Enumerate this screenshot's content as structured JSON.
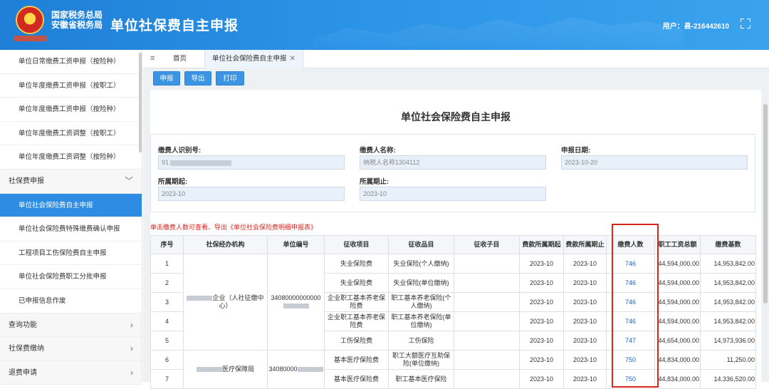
{
  "header": {
    "org_line1": "国家税务总局",
    "org_line2": "安徽省税务局",
    "title": "单位社保费自主申报",
    "user": "用户：县-216442610"
  },
  "sidebar": {
    "items": [
      {
        "label": "单位日常缴费工资申报（按险种）",
        "type": "item"
      },
      {
        "label": "单位年度缴费工资申报（按职工）",
        "type": "item"
      },
      {
        "label": "单位年度缴费工资申报（按险种）",
        "type": "item"
      },
      {
        "label": "单位年度缴费工资调整（按职工）",
        "type": "item"
      },
      {
        "label": "单位年度缴费工资调整（按险种）",
        "type": "item"
      },
      {
        "label": "社保费申报",
        "type": "group"
      },
      {
        "label": "单位社会保险费自主申报",
        "type": "active"
      },
      {
        "label": "单位社会保险费特殊缴费确认申报",
        "type": "item"
      },
      {
        "label": "工程项目工伤保险费自主申报",
        "type": "item"
      },
      {
        "label": "单位社会保险费职工分批申报",
        "type": "item"
      },
      {
        "label": "已申报信息作废",
        "type": "item"
      },
      {
        "label": "查询功能",
        "type": "group"
      },
      {
        "label": "社保费缴纳",
        "type": "group"
      },
      {
        "label": "退费申请",
        "type": "group"
      }
    ]
  },
  "tabs": {
    "home": "首页",
    "current": "单位社会保险费自主申报"
  },
  "toolbar": {
    "declare": "申报",
    "export": "导出",
    "print": "打印"
  },
  "page_title": "单位社会保险费自主申报",
  "form": {
    "payer_id_label": "缴费人识别号:",
    "payer_id_value": "91",
    "payer_name_label": "缴费人名称:",
    "payer_name_value": "纳税人名称1304112",
    "declare_date_label": "申报日期:",
    "declare_date_value": "2023-10-20",
    "period_start_label": "所属期起:",
    "period_start_value": "2023-10",
    "period_end_label": "所属期止:",
    "period_end_value": "2023-10"
  },
  "hint": "单击缴费人数可查看、导出《单位社会保险费明细申报表》",
  "table": {
    "headers": [
      "序号",
      "社保经办机构",
      "单位编号",
      "征收项目",
      "征收品目",
      "征收子目",
      "费款所属期起",
      "费款所属期止",
      "缴费人数",
      "职工工资总额",
      "缴费基数"
    ],
    "agency1": "（人社征缴中心）",
    "agency1_prefix": "企业",
    "unit_no1": "34080000000000",
    "agency2": "医疗保障局",
    "unit_no2": "34080000",
    "rows": [
      {
        "no": "1",
        "item": "失业保险费",
        "sub": "失业保险(个人缴纳)",
        "start": "2023-10",
        "end": "2023-10",
        "count": "746",
        "wage": "44,594,000.00",
        "base": "14,953,842.00"
      },
      {
        "no": "2",
        "item": "失业保险费",
        "sub": "失业保险(单位缴纳)",
        "start": "2023-10",
        "end": "2023-10",
        "count": "746",
        "wage": "44,594,000.00",
        "base": "14,953,842.00"
      },
      {
        "no": "3",
        "item": "企业职工基本养老保险费",
        "sub": "职工基本养老保险(个人缴纳)",
        "start": "2023-10",
        "end": "2023-10",
        "count": "746",
        "wage": "44,594,000.00",
        "base": "14,953,842.00"
      },
      {
        "no": "4",
        "item": "企业职工基本养老保险费",
        "sub": "职工基本养老保险(单位缴纳)",
        "start": "2023-10",
        "end": "2023-10",
        "count": "746",
        "wage": "44,594,000.00",
        "base": "14,953,842.00"
      },
      {
        "no": "5",
        "item": "工伤保险费",
        "sub": "工伤保险",
        "start": "2023-10",
        "end": "2023-10",
        "count": "747",
        "wage": "44,654,000.00",
        "base": "14,973,936.00"
      },
      {
        "no": "6",
        "item": "基本医疗保险费",
        "sub": "职工大额医疗互助保险(单位缴纳)",
        "start": "2023-10",
        "end": "2023-10",
        "count": "750",
        "wage": "44,834,000.00",
        "base": "11,250.00"
      },
      {
        "no": "7",
        "item": "基本医疗保险费",
        "sub": "职工基本医疗保险",
        "start": "2023-10",
        "end": "2023-10",
        "count": "750",
        "wage": "44,834,000.00",
        "base": "14,336,520.00"
      }
    ]
  },
  "colors": {
    "header": "#2b93e6",
    "accent": "#2e8de2",
    "highlight": "#d8261b",
    "link": "#1f5fb8"
  },
  "icons": [
    "emblem-icon",
    "menu-icon",
    "close-icon",
    "chevron-down-icon",
    "chevron-right-icon",
    "fullscreen-icon"
  ]
}
